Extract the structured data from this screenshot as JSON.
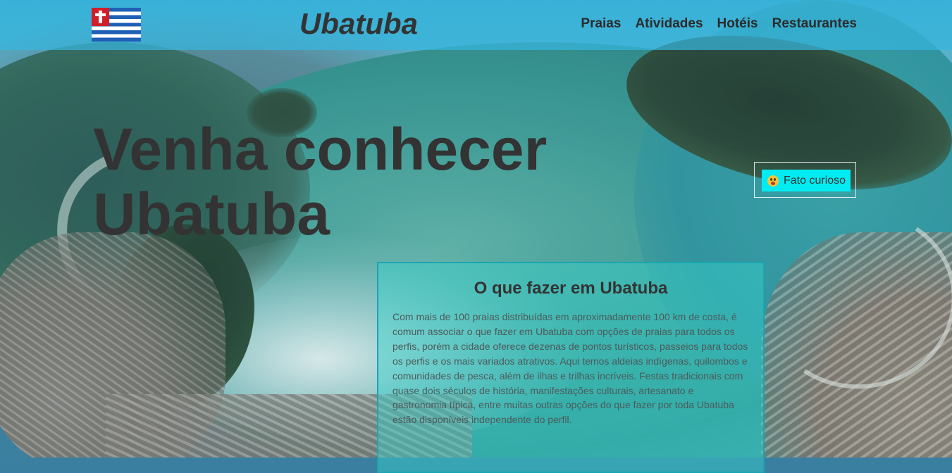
{
  "header": {
    "site_title": "Ubatuba",
    "nav": {
      "items": [
        "Praias",
        "Atividades",
        "Hotéis",
        "Restaurantes"
      ]
    }
  },
  "hero": {
    "title": "Venha conhecer Ubatuba"
  },
  "fact_button": {
    "label": "Fato curioso",
    "icon": "astonished-face-emoji"
  },
  "info_card": {
    "title": "O que fazer em Ubatuba",
    "text": "Com mais de 100 praias distribuídas em aproximadamente 100 km de costa, é comum associar o que fazer em Ubatuba com opções de praias para todos os perfis, porém a cidade oferece dezenas de pontos turísticos, passeios para todos os perfis e os mais variados atrativos. Aqui temos aldeias indígenas, quilombos e comunidades de pesca, além de ilhas e trilhas incríveis. Festas tradicionais com quase dois séculos de história, manifestações culturais, artesanato e gastronomia típica, entre muitas outras opções do que fazer por toda Ubatuba estão disponíveis independente do perfil."
  },
  "colors": {
    "header_bg": "#38b6de",
    "fact_button_bg": "#00ecf2",
    "card_border": "#1aa6b0",
    "text": "#333333"
  }
}
